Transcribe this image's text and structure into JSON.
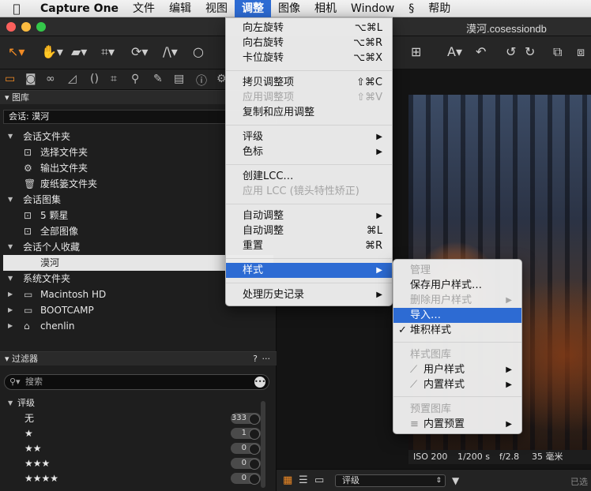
{
  "menubar": {
    "apple": "",
    "items": [
      "Capture One",
      "文件",
      "编辑",
      "视图",
      "调整",
      "图像",
      "相机",
      "Window",
      "帮助"
    ],
    "extra_icon": "script-icon"
  },
  "window": {
    "document_title": "漠河.cosessiondb"
  },
  "library": {
    "header": "图库",
    "session_label": "会话: 漠河",
    "sections": [
      {
        "title": "会话文件夹",
        "items": [
          "选择文件夹",
          "输出文件夹",
          "废纸篓文件夹"
        ]
      },
      {
        "title": "会话图集",
        "items": [
          "5 颗星",
          "全部图像"
        ]
      },
      {
        "title": "会话个人收藏",
        "items": [
          "漠河"
        ]
      },
      {
        "title": "系统文件夹",
        "items": [
          "Macintosh HD",
          "BOOTCAMP",
          "chenlin"
        ]
      }
    ]
  },
  "filters": {
    "header": "过滤器",
    "help": "?",
    "more": "···",
    "search_placeholder": "搜索",
    "rating_title": "评级",
    "ratings": [
      {
        "label": "无",
        "count": "333"
      },
      {
        "label": "★",
        "count": "1"
      },
      {
        "label": "★★",
        "count": "0"
      },
      {
        "label": "★★★",
        "count": "0"
      },
      {
        "label": "★★★★",
        "count": "0"
      }
    ]
  },
  "viewer": {
    "exif": {
      "iso": "ISO 200",
      "shutter": "1/200 s",
      "aperture": "f/2.8",
      "focal": "35 毫米"
    },
    "sort_label": "评级",
    "status_right": "已选"
  },
  "adjust_menu": [
    {
      "label": "向左旋转",
      "shortcut": "⌥⌘L",
      "enabled": true
    },
    {
      "label": "向右旋转",
      "shortcut": "⌥⌘R",
      "enabled": true
    },
    {
      "label": "卡位旋转",
      "shortcut": "⌥⌘X",
      "enabled": true
    },
    {
      "label": "拷贝调整项",
      "shortcut": "⇧⌘C",
      "enabled": true
    },
    {
      "label": "应用调整项",
      "shortcut": "⇧⌘V",
      "enabled": false
    },
    {
      "label": "复制和应用调整",
      "shortcut": "",
      "enabled": true
    },
    {
      "label": "评级",
      "submenu": true,
      "enabled": true
    },
    {
      "label": "色标",
      "submenu": true,
      "enabled": true
    },
    {
      "label": "创建LCC…",
      "enabled": true
    },
    {
      "label": "应用 LCC (镜头特性矫正)",
      "enabled": false
    },
    {
      "label": "自动调整",
      "submenu": true,
      "enabled": true
    },
    {
      "label": "自动调整",
      "shortcut": "⌘L",
      "enabled": true
    },
    {
      "label": "重置",
      "shortcut": "⌘R",
      "enabled": true
    },
    {
      "label": "样式",
      "submenu": true,
      "enabled": true,
      "highlighted": true
    },
    {
      "label": "处理历史记录",
      "submenu": true,
      "enabled": true
    }
  ],
  "styles_submenu": [
    {
      "label": "管理",
      "enabled": false
    },
    {
      "label": "保存用户样式…",
      "enabled": true
    },
    {
      "label": "删除用户样式",
      "enabled": false,
      "submenu": true
    },
    {
      "label": "导入…",
      "enabled": true,
      "highlighted": true
    },
    {
      "label": "堆积样式",
      "enabled": true,
      "checked": true
    },
    {
      "label": "样式图库",
      "enabled": false
    },
    {
      "label": "用户样式",
      "enabled": true,
      "submenu": true
    },
    {
      "label": "内置样式",
      "enabled": true,
      "submenu": true
    },
    {
      "label": "预置图库",
      "enabled": false
    },
    {
      "label": "内置预置",
      "enabled": true,
      "submenu": true
    }
  ],
  "colors": {
    "accent": "#2d6bd3",
    "close": "#fc605c",
    "minimize": "#fdbc40",
    "zoom": "#34c84a"
  }
}
